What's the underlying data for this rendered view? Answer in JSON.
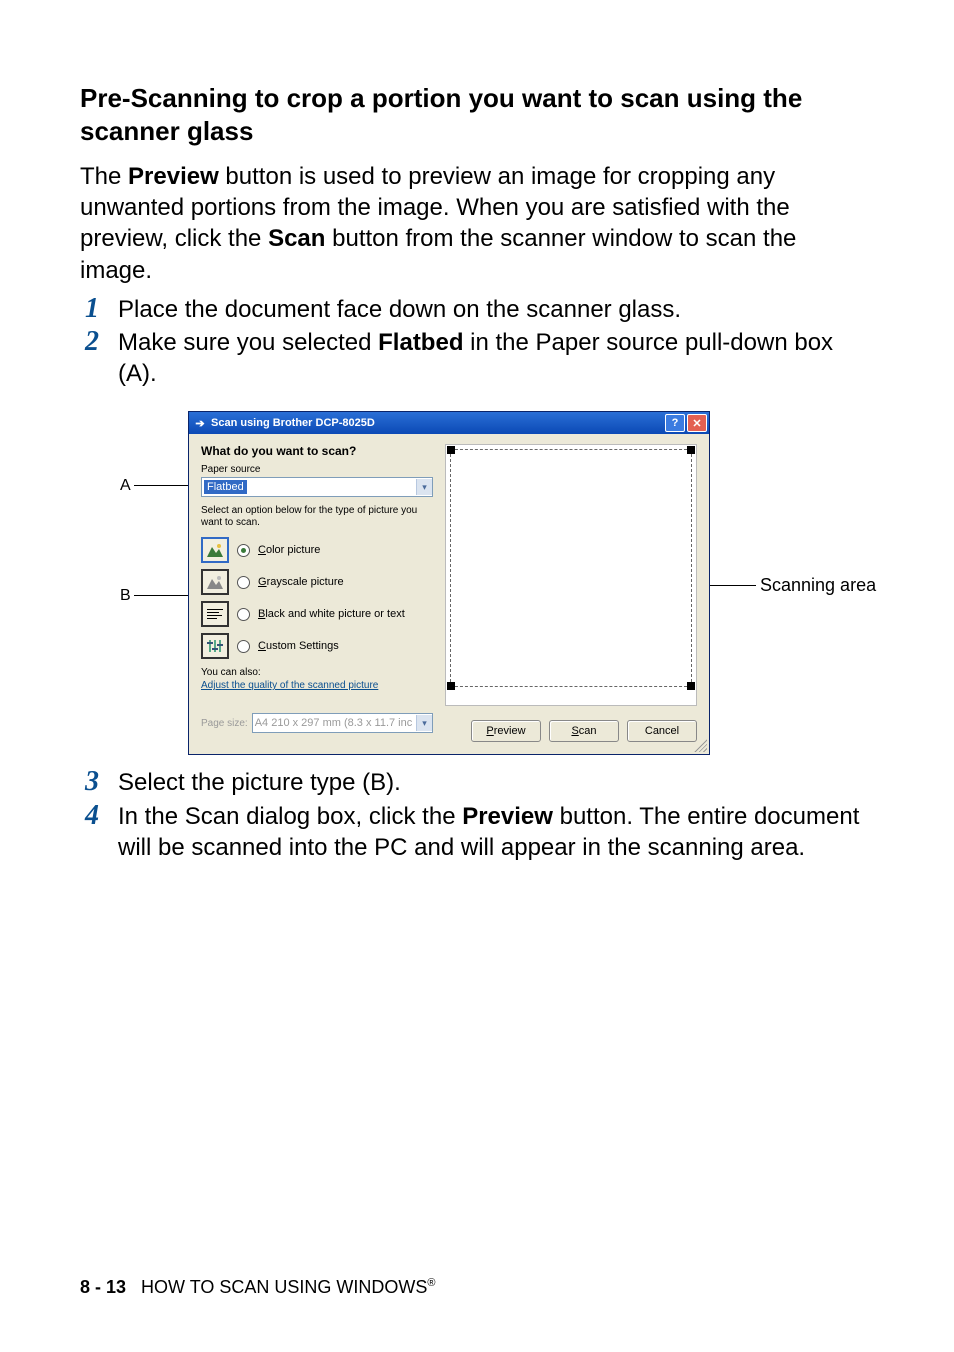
{
  "heading": "Pre-Scanning to crop a portion you want to scan using the scanner glass",
  "intro_parts": {
    "p1a": "The ",
    "p1b": "Preview",
    "p1c": " button is used to preview an image for cropping any unwanted portions from the image. When you are satisfied with the preview, click the ",
    "p1d": "Scan",
    "p1e": " button from the scanner window to scan the image."
  },
  "steps": {
    "s1": "Place the document face down on the scanner glass.",
    "s2a": "Make sure you selected ",
    "s2b": "Flatbed",
    "s2c": " in the Paper source pull-down box (A).",
    "s3": "Select the picture type (B).",
    "s4a": "In the Scan dialog box, click the ",
    "s4b": "Preview",
    "s4c": " button. The entire document will be scanned into the PC and will appear in the scanning area."
  },
  "nums": {
    "n1": "1",
    "n2": "2",
    "n3": "3",
    "n4": "4"
  },
  "labels": {
    "A": "A",
    "B": "B",
    "scanning_area": "Scanning area"
  },
  "dialog": {
    "title": "Scan using Brother DCP-8025D",
    "what": "What do you want to scan?",
    "paper_source_label": "Paper source",
    "paper_source_value": "Flatbed",
    "select_note": "Select an option below for the type of picture you want to scan.",
    "opt_color": "olor picture",
    "opt_color_u": "C",
    "opt_gray": "rayscale picture",
    "opt_gray_u": "G",
    "opt_bw": "lack and white picture or text",
    "opt_bw_u": "B",
    "opt_custom": "ustom Settings",
    "opt_custom_u": "C",
    "you_can": "You can also:",
    "adjust_link": "Adjust the quality of the scanned picture",
    "page_size_label": "Page size:",
    "page_size_value": "A4 210 x 297 mm (8.3 x 11.7 inc",
    "btn_preview": "Preview",
    "btn_preview_u": "P",
    "btn_scan": "can",
    "btn_scan_u": "S",
    "btn_cancel": "Cancel"
  },
  "footer": {
    "page": "8 - 13",
    "text": "HOW TO SCAN USING WINDOWS",
    "reg": "®"
  }
}
